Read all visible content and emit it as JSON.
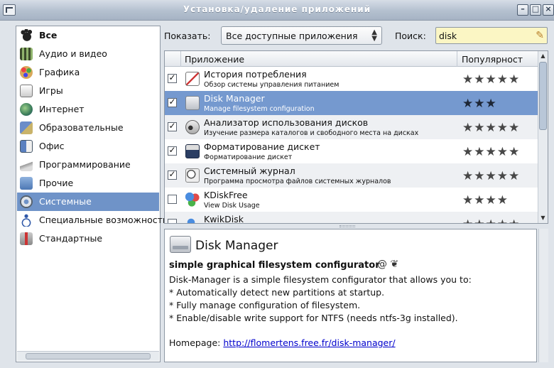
{
  "window": {
    "title": "Установка/удаление приложений"
  },
  "titlebar_buttons": {
    "minimize": "–",
    "maximize": "□",
    "close": "×"
  },
  "categories": [
    {
      "label": "Все",
      "icon": "gnome-foot-icon",
      "selected": false
    },
    {
      "label": "Аудио и видео",
      "icon": "film-icon",
      "selected": false
    },
    {
      "label": "Графика",
      "icon": "palette-icon",
      "selected": false
    },
    {
      "label": "Игры",
      "icon": "game-icon",
      "selected": false
    },
    {
      "label": "Интернет",
      "icon": "globe-icon",
      "selected": false
    },
    {
      "label": "Образовательные",
      "icon": "education-icon",
      "selected": false
    },
    {
      "label": "Офис",
      "icon": "office-icon",
      "selected": false
    },
    {
      "label": "Программирование",
      "icon": "programming-icon",
      "selected": false
    },
    {
      "label": "Прочие",
      "icon": "folder-icon",
      "selected": false
    },
    {
      "label": "Системные",
      "icon": "gear-icon",
      "selected": true
    },
    {
      "label": "Специальные возможности",
      "icon": "accessibility-icon",
      "selected": false
    },
    {
      "label": "Стандартные",
      "icon": "accessories-icon",
      "selected": false
    }
  ],
  "filter": {
    "show_label": "Показать:",
    "show_value": "Все доступные приложения",
    "search_label": "Поиск:",
    "search_value": "disk"
  },
  "table": {
    "col_app": "Приложение",
    "col_popularity": "Популярност",
    "rows": [
      {
        "checked": true,
        "name": "История потребления",
        "desc": "Обзор системы управления питанием",
        "stars": 5,
        "selected": false
      },
      {
        "checked": true,
        "name": "Disk Manager",
        "desc": "Manage filesystem configuration",
        "stars": 3,
        "selected": true
      },
      {
        "checked": true,
        "name": "Анализатор использования дисков",
        "desc": "Изучение размера каталогов и свободного места на дисках",
        "stars": 5,
        "selected": false
      },
      {
        "checked": true,
        "name": "Форматирование дискет",
        "desc": "Форматирование дискет",
        "stars": 5,
        "selected": false
      },
      {
        "checked": true,
        "name": "Системный журнал",
        "desc": "Программа просмотра файлов системных журналов",
        "stars": 5,
        "selected": false
      },
      {
        "checked": false,
        "name": "KDiskFree",
        "desc": "View Disk Usage",
        "stars": 4,
        "selected": false
      },
      {
        "checked": false,
        "name": "KwikDisk",
        "desc": "",
        "stars": 5,
        "selected": false
      }
    ]
  },
  "details": {
    "title": "Disk Manager",
    "subtitle": "simple graphical filesystem configurator",
    "lines": [
      "Disk-Manager is a simple filesystem configurator that allows you to:",
      "* Automatically detect new partitions at startup.",
      "* Fully manage configuration of filesystem.",
      "* Enable/disable write support for NTFS (needs ntfs-3g installed)."
    ],
    "homepage_label": "Homepage:",
    "homepage_url": "http://flomertens.free.fr/disk-manager/"
  },
  "colors": {
    "selection": "#6f93c8",
    "search_bg": "#fbf6c4",
    "link": "#0000cc"
  }
}
